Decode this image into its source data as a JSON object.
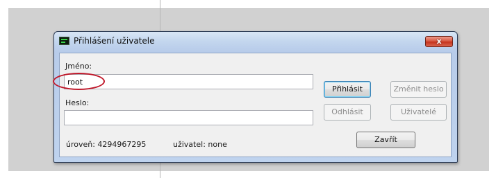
{
  "window": {
    "title": "Přihlášení uživatele",
    "close_glyph": "x",
    "icon": "terminal-app-icon"
  },
  "form": {
    "name_label": "Jméno:",
    "name_value": "root",
    "password_label": "Heslo:",
    "password_value": ""
  },
  "buttons": {
    "login": "Přihlásit",
    "change_password": "Změnit heslo",
    "logout": "Odhlásit",
    "users": "Uživatelé",
    "close": "Zavřít"
  },
  "status": {
    "level": "úroveň: 4294967295",
    "user": "uživatel: none"
  },
  "colors": {
    "annotation_ellipse": "#c0182a",
    "title_bar": "#c3d6ee",
    "close_button": "#c5311b"
  }
}
